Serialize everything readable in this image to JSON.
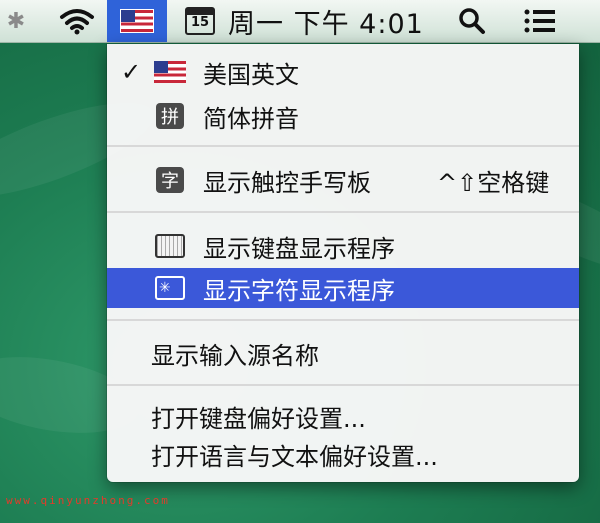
{
  "menubar": {
    "bluetooth_glyph": "✱",
    "icons": [
      "bluetooth-icon",
      "wifi-icon",
      "flag-us-icon",
      "calendar-icon",
      "search-icon",
      "menu-list-icon"
    ],
    "calendar_day": "15",
    "datetime": "周一 下午 4:01",
    "colors": {
      "highlight": "#3b58d9",
      "menubar_top": "#f2f7f3",
      "menubar_bottom": "#cfe1d6"
    }
  },
  "menu": {
    "check_glyph": "✓",
    "items": [
      {
        "id": "us-english",
        "label": "美国英文",
        "checked": true,
        "icon": "flag-us-icon"
      },
      {
        "id": "pinyin",
        "label": "简体拼音",
        "icon": "pinyin-icon",
        "icon_glyph": "拼"
      },
      {
        "id": "handwriting",
        "label": "显示触控手写板",
        "icon": "handwriting-icon",
        "icon_glyph": "字",
        "shortcut": "^⇧空格键"
      },
      {
        "id": "keyboard-viewer",
        "label": "显示键盘显示程序",
        "icon": "keyboard-viewer-icon"
      },
      {
        "id": "character-viewer",
        "label": "显示字符显示程序",
        "icon": "character-viewer-icon",
        "icon_glyph": "✳",
        "highlighted": true
      },
      {
        "id": "input-source-name",
        "label": "显示输入源名称"
      },
      {
        "id": "keyboard-prefs",
        "label": "打开键盘偏好设置..."
      },
      {
        "id": "language-prefs",
        "label": "打开语言与文本偏好设置..."
      }
    ]
  },
  "watermark": "www.qinyunzhong.com"
}
